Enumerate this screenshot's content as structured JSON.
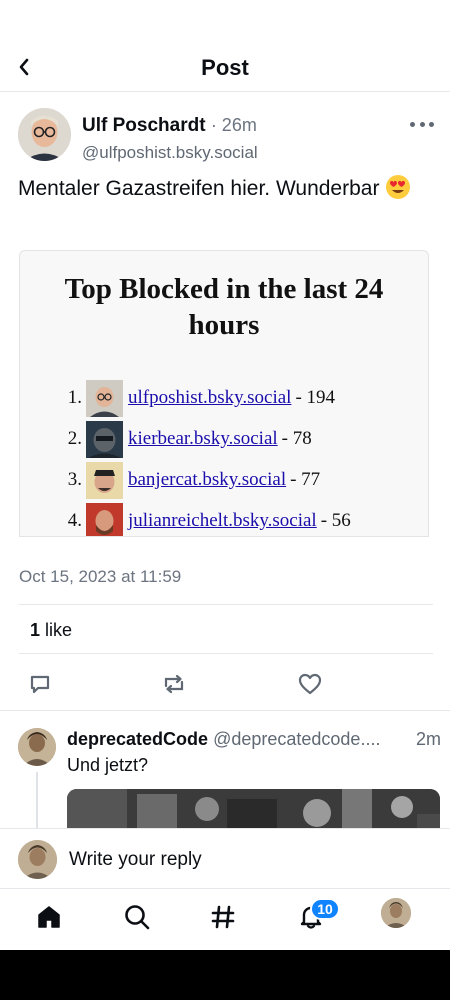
{
  "header": {
    "title": "Post",
    "back_icon": "chevron-left-icon"
  },
  "post": {
    "author_name": "Ulf Poschardt",
    "time": "· 26m",
    "handle": "@ulfposhist.bsky.social",
    "text": "Mentaler Gazastreifen hier. Wunderbar",
    "emoji": "heart-eyes-emoji",
    "embed": {
      "title": "Top Blocked in the last 24 hours",
      "items": [
        {
          "rank": "1.",
          "handle": "ulfposhist.bsky.social",
          "count": "- 194"
        },
        {
          "rank": "2.",
          "handle": "kierbear.bsky.social",
          "count": "- 78"
        },
        {
          "rank": "3.",
          "handle": "banjercat.bsky.social",
          "count": "- 77"
        },
        {
          "rank": "4.",
          "handle": "julianreichelt.bsky.social",
          "count": "- 56"
        }
      ]
    },
    "timestamp": "Oct 15, 2023 at 11:59",
    "likes_count": "1",
    "likes_label": " like",
    "actions": [
      "reply-icon",
      "repost-icon",
      "like-icon"
    ]
  },
  "reply": {
    "name": "deprecatedCode",
    "handle": "@deprecatedcode....",
    "time": "2m",
    "text": "Und jetzt?"
  },
  "composer": {
    "placeholder": "Write your reply"
  },
  "nav": {
    "items": [
      "home-icon",
      "search-icon",
      "feeds-hash-icon",
      "notifications-icon",
      "profile-avatar"
    ],
    "notification_badge": "10"
  },
  "colors": {
    "accent": "#1083fe",
    "link": "#1a0dab",
    "muted": "#6b7480"
  }
}
